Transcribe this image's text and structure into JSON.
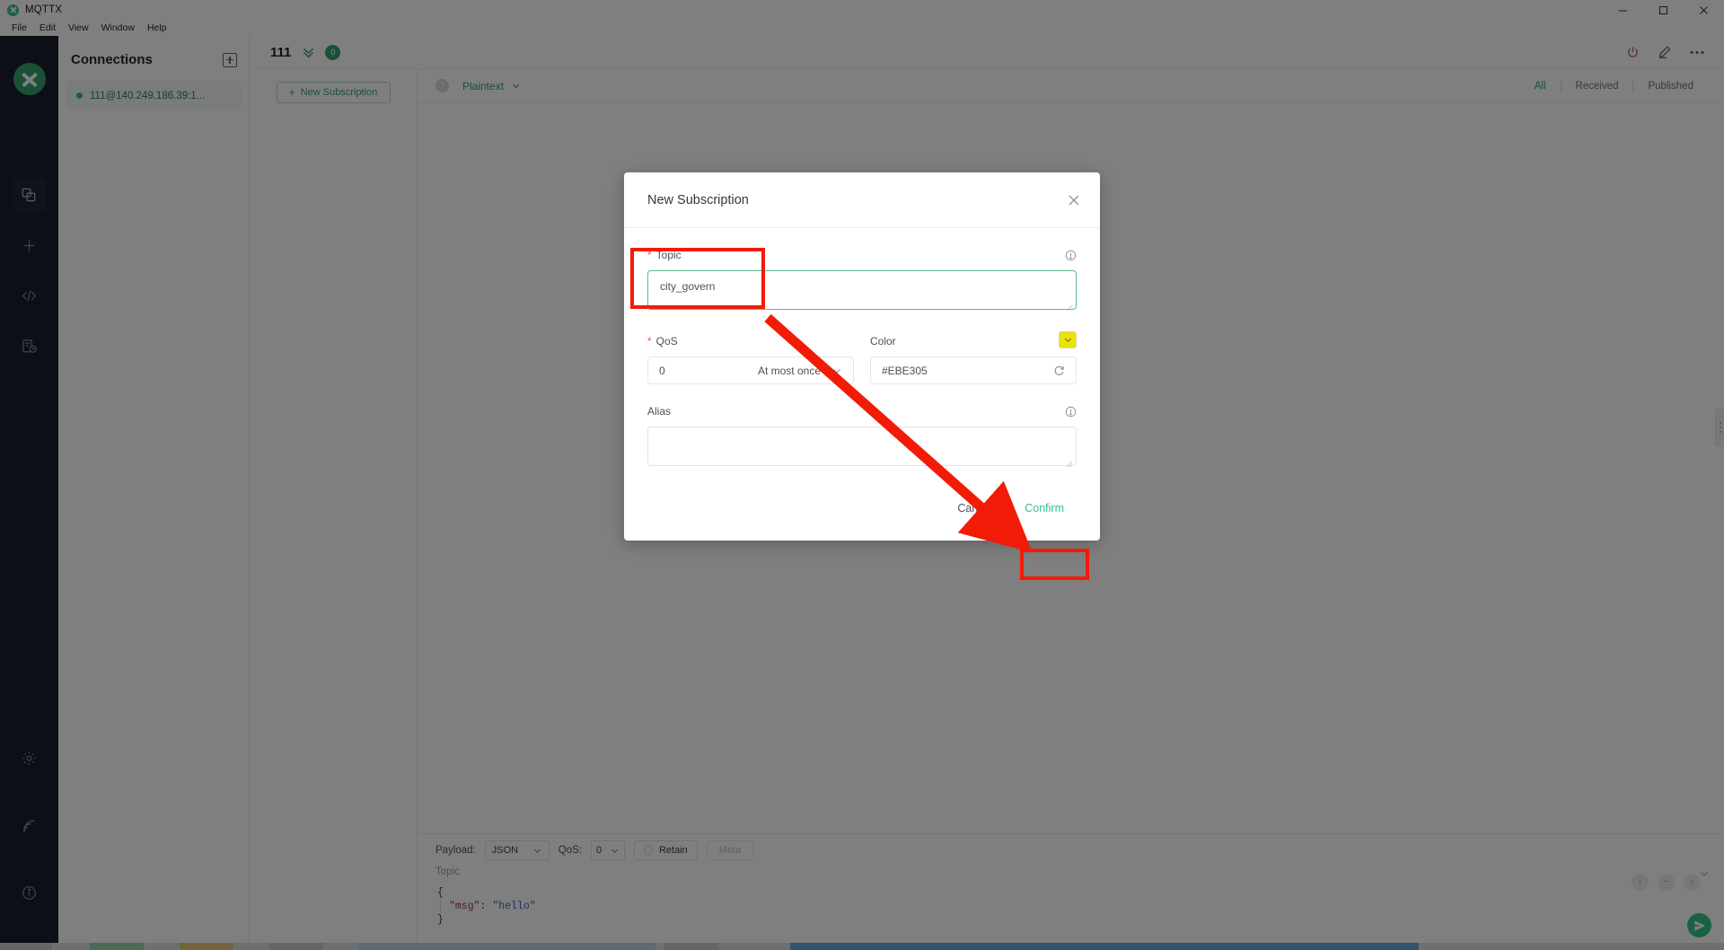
{
  "window": {
    "app_title": "MQTTX",
    "logo_icon": "mqttx-logo-icon",
    "controls": [
      {
        "name": "minimize",
        "icon": "minimize-icon"
      },
      {
        "name": "maximize",
        "icon": "maximize-icon"
      },
      {
        "name": "close",
        "icon": "close-icon"
      }
    ]
  },
  "menubar": {
    "items": [
      "File",
      "Edit",
      "View",
      "Window",
      "Help"
    ]
  },
  "rail": {
    "avatar_icon": "mqttx-avatar-icon",
    "items": [
      {
        "name": "connections",
        "icon": "copy-squares-icon",
        "active": true
      },
      {
        "name": "new-connection",
        "icon": "plus-icon",
        "active": false
      },
      {
        "name": "scripts",
        "icon": "code-brackets-icon",
        "active": false
      },
      {
        "name": "log",
        "icon": "log-clock-icon",
        "active": false
      }
    ],
    "bottom_items": [
      {
        "name": "settings",
        "icon": "gear-icon"
      },
      {
        "name": "broker",
        "icon": "signal-waves-icon"
      },
      {
        "name": "about",
        "icon": "info-circle-icon"
      }
    ]
  },
  "connections": {
    "title": "Connections",
    "add_icon": "plus-box-icon",
    "items": [
      {
        "label": "111@140.249.186.39:1...",
        "status": "connected"
      }
    ]
  },
  "main_header": {
    "title": "111",
    "chevrons_icon": "double-chevron-down-icon",
    "badge": "0",
    "actions": [
      {
        "name": "disconnect",
        "icon": "power-icon"
      },
      {
        "name": "edit-connection",
        "icon": "pencil-icon"
      },
      {
        "name": "more-options",
        "icon": "ellipsis-icon"
      }
    ]
  },
  "subscriptions": {
    "new_subscription_label": "New Subscription",
    "plus": "+"
  },
  "message_bar": {
    "help_icon": "question-circle-icon",
    "format_label": "Plaintext",
    "format_chevron": "chevron-down-icon",
    "tabs": [
      {
        "label": "All",
        "active": true
      },
      {
        "label": "Received",
        "active": false
      },
      {
        "label": "Published",
        "active": false
      }
    ]
  },
  "publish": {
    "payload_label": "Payload:",
    "payload_value": "JSON",
    "qos_label": "QoS:",
    "qos_value": "0",
    "retain_label": "Retain",
    "meta_label": "Meta",
    "topic_placeholder": "Topic",
    "editor": {
      "line1": "{",
      "key": "\"msg\"",
      "colon": ": ",
      "value": "\"hello\"",
      "line3": "}"
    },
    "send_icon": "send-plane-icon",
    "action_icons": [
      "chevron-left-icon",
      "minus-icon",
      "chevron-right-icon"
    ],
    "collapse_icon": "chevron-down-icon"
  },
  "modal": {
    "title": "New Subscription",
    "close_icon": "close-icon",
    "topic": {
      "label": "Topic",
      "required_mark": "*",
      "value": "city_govern",
      "info_icon": "info-circle-icon"
    },
    "qos": {
      "label": "QoS",
      "required_mark": "*",
      "value": "0",
      "text": "At most once",
      "chevron_icon": "chevron-down-icon"
    },
    "color": {
      "label": "Color",
      "value": "#EBE305",
      "swatch_hex": "#EBE305",
      "swatch_icon": "chevron-down-icon",
      "refresh_icon": "refresh-icon"
    },
    "alias": {
      "label": "Alias",
      "value": "",
      "info_icon": "info-circle-icon"
    },
    "cancel_label": "Cancel",
    "confirm_label": "Confirm"
  },
  "annotations": {
    "highlight_color": "#f21b07",
    "boxes": [
      "topic-field-highlight",
      "confirm-button-highlight"
    ],
    "arrow": "topic-to-confirm-arrow"
  }
}
